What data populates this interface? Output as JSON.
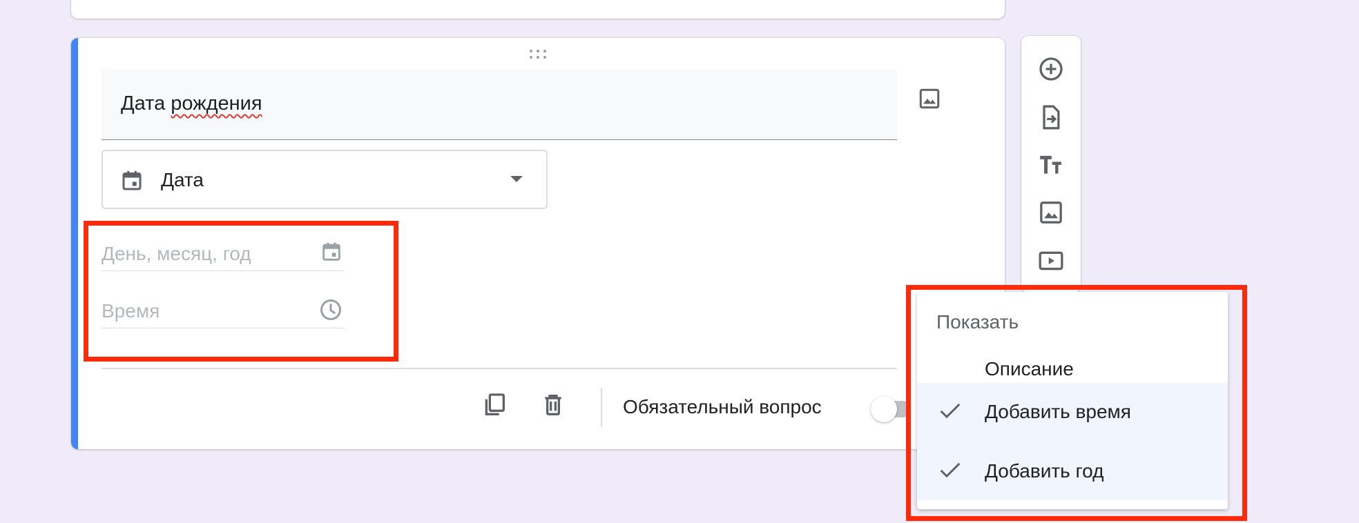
{
  "question": {
    "title_prefix": "Дата ",
    "title_misspelled": "рождения",
    "type_label": "Дата",
    "date_placeholder": "День, месяц, год",
    "time_placeholder": "Время",
    "required_label": "Обязательный вопрос",
    "required_on": false
  },
  "menu": {
    "header": "Показать",
    "items": [
      {
        "label": "Описание",
        "checked": false
      },
      {
        "label": "Добавить время",
        "checked": true
      },
      {
        "label": "Добавить год",
        "checked": true
      }
    ]
  },
  "toolbar": {
    "icons": [
      "add-question-icon",
      "import-questions-icon",
      "add-title-icon",
      "add-image-icon",
      "add-video-icon"
    ]
  },
  "colors": {
    "background": "#f0ebf8",
    "accent": "#4285f4",
    "highlight": "#ff2a0a"
  }
}
